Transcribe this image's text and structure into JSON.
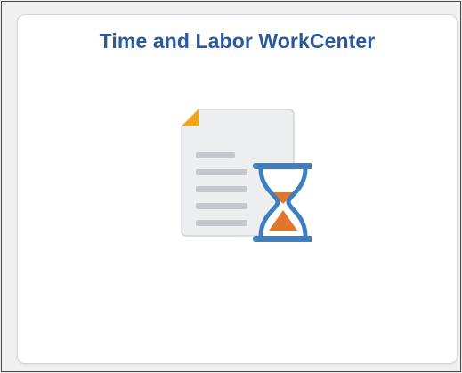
{
  "tile": {
    "title": "Time and Labor WorkCenter",
    "icon": "document-hourglass-icon"
  },
  "colors": {
    "title": "#2a5a9b",
    "page_background": "#ececec",
    "tile_background": "#ffffff",
    "tile_border": "#cfd6dc",
    "document_body": "#eceef0",
    "document_corner": "#f2a516",
    "document_lines": "#c4c8cc",
    "hourglass_frame": "#3d7fc1",
    "hourglass_sand": "#e0762b"
  }
}
